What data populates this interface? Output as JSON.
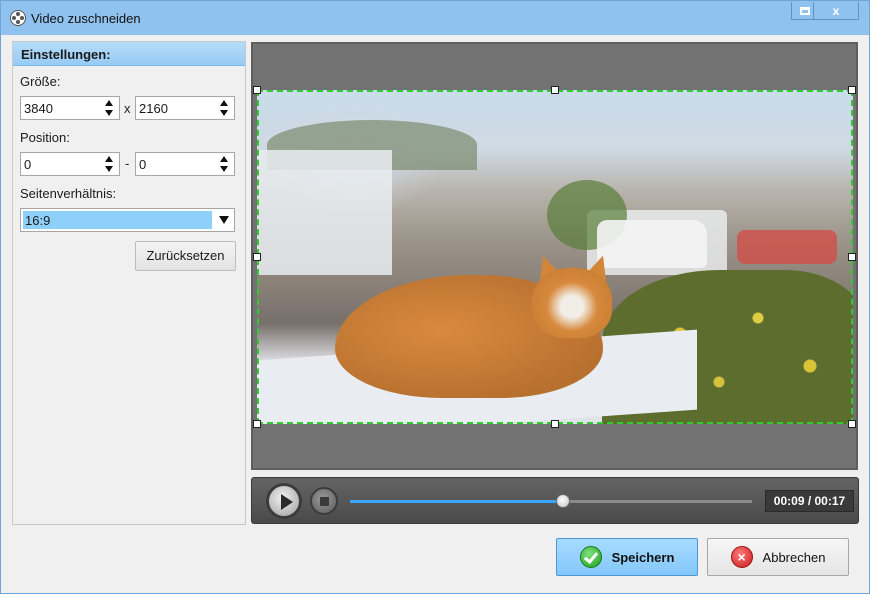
{
  "window": {
    "title": "Video zuschneiden",
    "close_glyph": "x"
  },
  "settings": {
    "header": "Einstellungen:",
    "size_label": "Größe:",
    "width": "3840",
    "size_separator": "x",
    "height": "2160",
    "position_label": "Position:",
    "pos_x": "0",
    "position_separator": "-",
    "pos_y": "0",
    "aspect_label": "Seitenverhältnis:",
    "aspect_value": "16:9",
    "reset_label": "Zurücksetzen"
  },
  "player": {
    "time": "00:09 / 00:17",
    "progress": 0.53
  },
  "actions": {
    "save_label": "Speichern",
    "cancel_label": "Abbrechen",
    "cancel_glyph": "×"
  },
  "icons": {
    "app": "film-reel-icon",
    "maximize": "maximize-icon",
    "close": "close-icon",
    "play": "play-icon",
    "stop": "stop-icon",
    "ok": "checkmark-icon",
    "cancel": "cancel-icon"
  },
  "colors": {
    "accent": "#8fc2ee",
    "crop_border": "#2ecc2e",
    "progress": "#39a6ff"
  }
}
